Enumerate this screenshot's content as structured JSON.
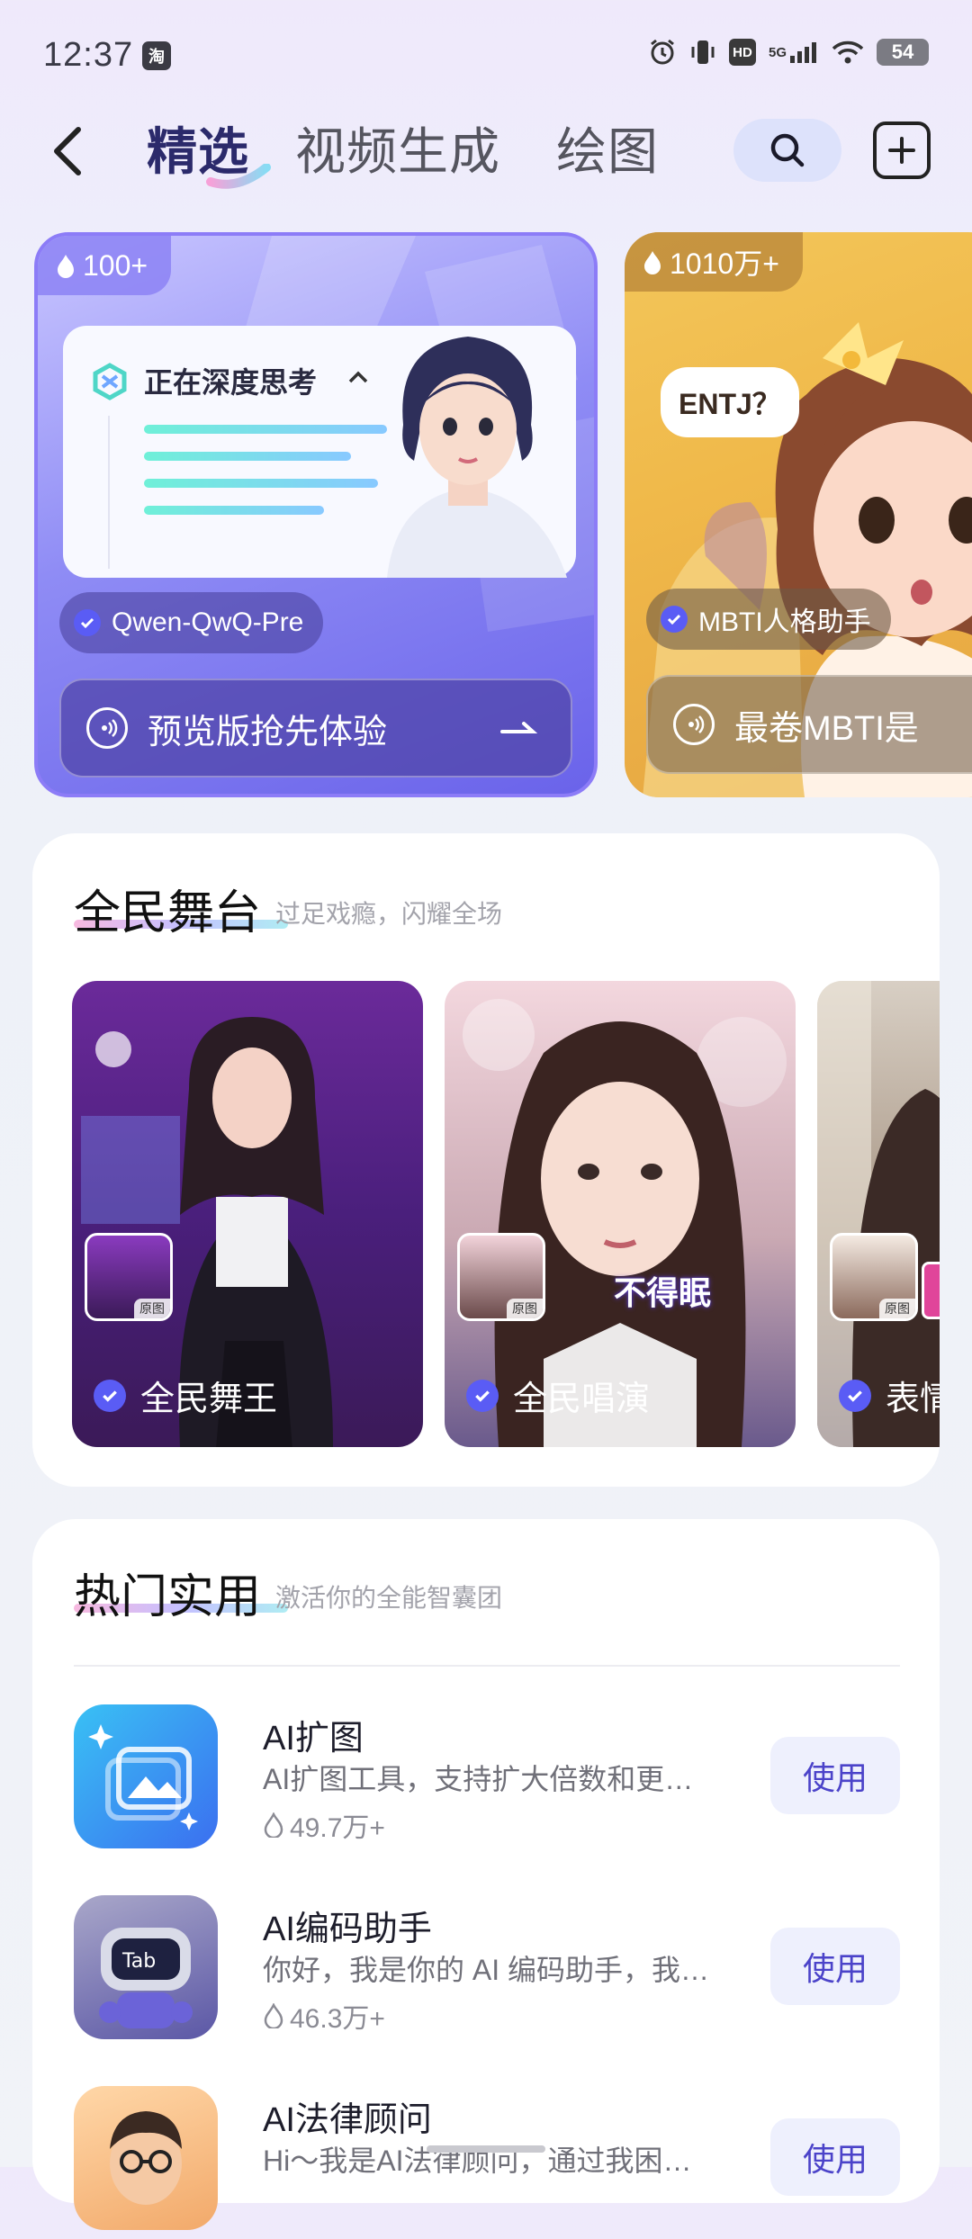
{
  "status": {
    "time": "12:37",
    "app_icon_text": "淘",
    "network": "5G",
    "hd_label": "HD",
    "battery": "54"
  },
  "header": {
    "tabs": [
      {
        "label": "精选",
        "active": true
      },
      {
        "label": "视频生成",
        "active": false
      },
      {
        "label": "绘图",
        "active": false
      }
    ]
  },
  "banners": [
    {
      "heat": "100+",
      "thinking_title": "正在深度思考",
      "model_tag": "Qwen-QwQ-Pre",
      "cta": "预览版抢先体验",
      "accent": "#6a63ea"
    },
    {
      "heat": "1010万+",
      "speech": "ENTJ？",
      "model_tag": "MBTI人格助手",
      "cta": "最卷MBTI是",
      "accent": "#f0b94a"
    }
  ],
  "stage_section": {
    "title": "全民舞台",
    "subtitle": "过足戏瘾，闪耀全场",
    "cards": [
      {
        "label": "全民舞王",
        "orig": "原图"
      },
      {
        "label": "全民唱演",
        "orig": "原图",
        "caption": "不得眠"
      },
      {
        "label": "表情",
        "orig": "原图"
      }
    ]
  },
  "hot_section": {
    "title": "热门实用",
    "subtitle": "激活你的全能智囊团",
    "apps": [
      {
        "name": "AI扩图",
        "desc": "AI扩图工具，支持扩大倍数和更…",
        "count": "49.7万+",
        "button": "使用"
      },
      {
        "name": "AI编码助手",
        "desc": "你好，我是你的 AI 编码助手，我…",
        "count": "46.3万+",
        "button": "使用"
      },
      {
        "name": "AI法律顾问",
        "desc": "Hi～我是AI法律顾问，通过我困…",
        "count": "",
        "button": "使用"
      }
    ]
  },
  "colors": {
    "brand": "#4b43c9",
    "active_tab": "#2b2a6b"
  }
}
